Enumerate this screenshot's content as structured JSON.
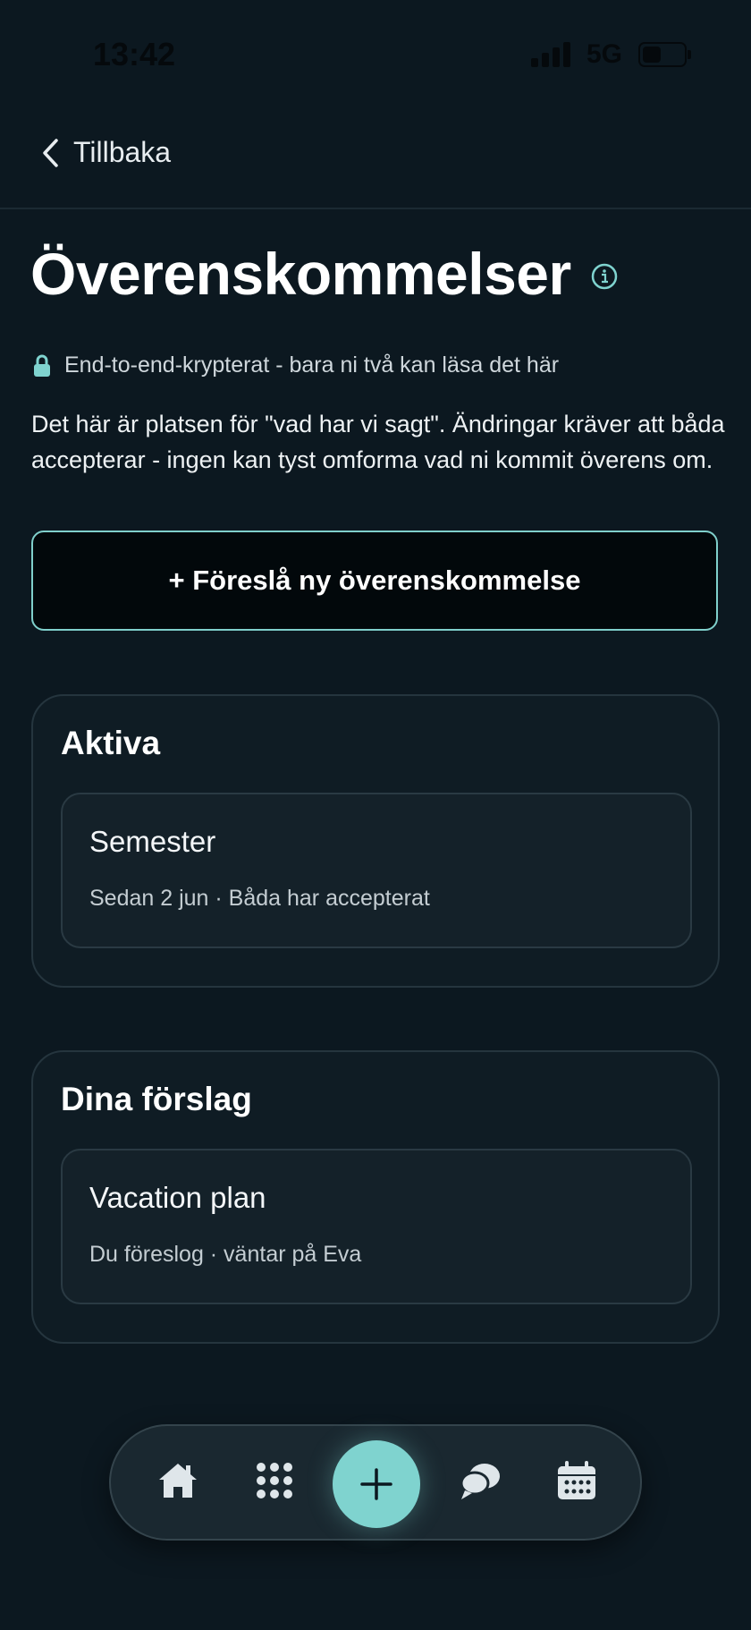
{
  "status_bar": {
    "time": "13:42",
    "network": "5G"
  },
  "header": {
    "back_label": "Tillbaka"
  },
  "page": {
    "title": "Överenskommelser",
    "encryption_note": "End-to-end-krypterat - bara ni två kan läsa det här",
    "description": "Det här är platsen för \"vad har vi sagt\". Ändringar kräver att båda accepterar - ingen kan tyst omforma vad ni kommit överens om.",
    "propose_button": "+ Föreslå ny överenskommelse"
  },
  "sections": [
    {
      "title": "Aktiva",
      "items": [
        {
          "title": "Semester",
          "meta": "Sedan 2 jun · Båda har accepterat"
        }
      ]
    },
    {
      "title": "Dina förslag",
      "items": [
        {
          "title": "Vacation plan",
          "meta": "Du föreslog · väntar på Eva"
        }
      ]
    }
  ],
  "nav": {
    "items": [
      "home-icon",
      "apps-grid-icon",
      "plus-icon",
      "chat-icon",
      "calendar-icon"
    ]
  },
  "colors": {
    "background": "#0c1820",
    "accent": "#7fd3cf",
    "card": "#0f1c24",
    "item_card": "#142129"
  }
}
